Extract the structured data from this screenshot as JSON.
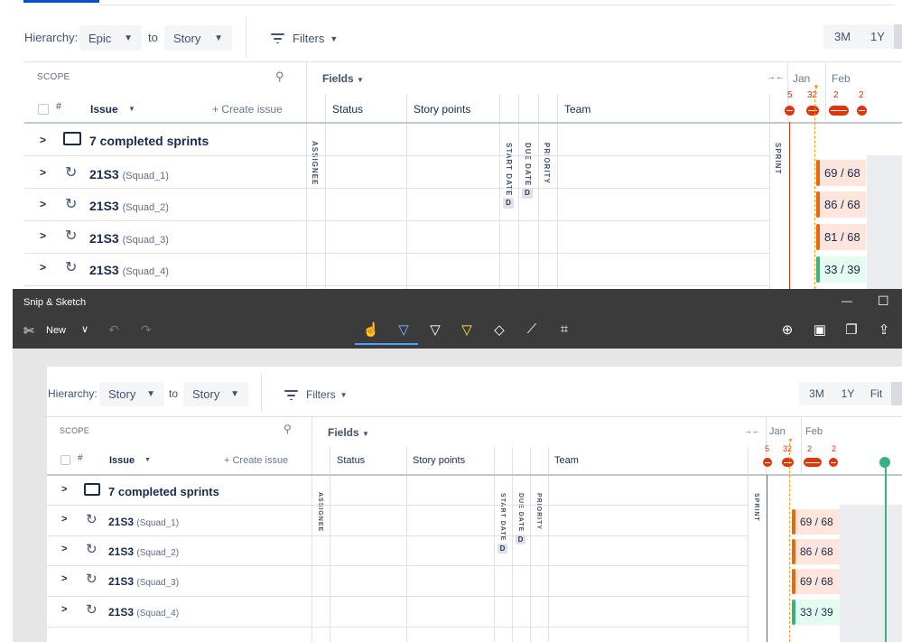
{
  "top": {
    "hierarchy_label": "Hierarchy:",
    "from_value": "Epic",
    "to_label": "to",
    "to_value": "Story",
    "filters_label": "Filters",
    "zoom_options": [
      "3M",
      "1Y"
    ],
    "scope_label": "SCOPE",
    "fields_label": "Fields",
    "issue_header": "Issue",
    "hash": "#",
    "create_issue": "+ Create issue",
    "col_status": "Status",
    "col_story_points": "Story points",
    "col_team": "Team",
    "v_assignee": "ASSIGNEE",
    "v_start_date": "START DATE",
    "v_due_date": "DUE DATE",
    "v_priority": "PRIORITY",
    "v_sprint": "SPRINT",
    "d_badge": "D",
    "months": [
      "Jan",
      "Feb"
    ],
    "marker_numbers": [
      "5",
      "32",
      "2",
      "2"
    ],
    "completed_row": "7 completed sprints",
    "rows": [
      {
        "name": "21S3",
        "squad": "(Squad_1)",
        "capacity": "69 / 68",
        "status": "over"
      },
      {
        "name": "21S3",
        "squad": "(Squad_2)",
        "capacity": "86 / 68",
        "status": "over"
      },
      {
        "name": "21S3",
        "squad": "(Squad_3)",
        "capacity": "81 / 68",
        "status": "over"
      },
      {
        "name": "21S3",
        "squad": "(Squad_4)",
        "capacity": "33 / 39",
        "status": "under"
      }
    ]
  },
  "snip": {
    "title": "Snip & Sketch",
    "new_label": "New",
    "minimize": "—",
    "maximize": "☐"
  },
  "inner": {
    "hierarchy_label": "Hierarchy:",
    "from_value": "Story",
    "to_label": "to",
    "to_value": "Story",
    "filters_label": "Filters",
    "zoom_options": [
      "3M",
      "1Y",
      "Fit"
    ],
    "scope_label": "SCOPE",
    "fields_label": "Fields",
    "issue_header": "Issue",
    "hash": "#",
    "create_issue": "+ Create issue",
    "col_status": "Status",
    "col_story_points": "Story points",
    "col_team": "Team",
    "v_assignee": "ASSIGNEE",
    "v_start_date": "START DATE",
    "v_due_date": "DUE DATE",
    "v_priority": "PRIORITY",
    "v_sprint": "SPRINT",
    "d_badge": "D",
    "months": [
      "Jan",
      "Feb"
    ],
    "marker_numbers": [
      "5",
      "32",
      "2",
      "2"
    ],
    "completed_row": "7 completed sprints",
    "rows": [
      {
        "name": "21S3",
        "squad": "(Squad_1)",
        "capacity": "69 / 68",
        "status": "over"
      },
      {
        "name": "21S3",
        "squad": "(Squad_2)",
        "capacity": "86 / 68",
        "status": "over"
      },
      {
        "name": "21S3",
        "squad": "(Squad_3)",
        "capacity": "69 / 68",
        "status": "over"
      },
      {
        "name": "21S3",
        "squad": "(Squad_4)",
        "capacity": "33 / 39",
        "status": "under"
      }
    ]
  },
  "colors": {
    "over": "#e56910",
    "under": "#36b37e",
    "today": "#de350b",
    "release": "#ff991f"
  }
}
